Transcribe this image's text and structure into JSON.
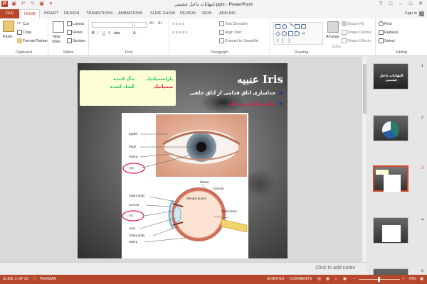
{
  "window": {
    "title": "انتهابات داخل چشمی.pptx - PowerPoint"
  },
  "tabs": [
    "FILE",
    "HOME",
    "INSERT",
    "DESIGN",
    "TRANSITIONS",
    "ANIMATIONS",
    "SLIDE SHOW",
    "REVIEW",
    "VIEW",
    "ADD-INS"
  ],
  "active_tab": "HOME",
  "account": {
    "sign_in": "Sign in"
  },
  "ribbon": {
    "clipboard": {
      "paste": "Paste",
      "cut": "Cut",
      "copy": "Copy",
      "format_painter": "Format Painter",
      "label": "Clipboard"
    },
    "slides": {
      "new_slide": "New",
      "new_slide_2": "Slide",
      "layout": "Layout",
      "reset": "Reset",
      "section": "Section",
      "label": "Slides"
    },
    "font": {
      "label": "Font"
    },
    "paragraph": {
      "text_direction": "Text Direction",
      "align_text": "Align Text",
      "convert_smartart": "Convert to SmartArt",
      "label": "Paragraph"
    },
    "drawing": {
      "arrange": "Arrange",
      "quick_styles": "Quick",
      "quick_styles_2": "Styles",
      "shape_fill": "Shape Fill",
      "shape_outline": "Shape Outline",
      "shape_effects": "Shape Effects",
      "label": "Drawing"
    },
    "editing": {
      "find": "Find",
      "replace": "Replace",
      "select": "Select",
      "label": "Editing"
    }
  },
  "slide": {
    "title": "عنبیه Iris",
    "legend": {
      "row1_label": "تنگ کننده",
      "row1_value": "پاراسمپاتیک",
      "row2_label": "گشاد کننده",
      "row2_value": "سمپاتیک"
    },
    "bullets": [
      "جداسازی اتاق قدامی از اتاق خلفی",
      "تنظیم قطر مردمک"
    ],
    "figure_labels": {
      "eyelid": "Eyelid",
      "pupil": "Pupil",
      "sclera": "Sclera",
      "iris": "Iris",
      "ciliary_body": "Ciliary body",
      "cornea": "Cornea",
      "iris2": "Iris",
      "lens": "Lens",
      "ciliary_body2": "Ciliary body",
      "sclera2": "Sclera",
      "retina": "Retina",
      "choroid": "Choroid",
      "vitreous_humor": "Vitreous humor",
      "optic_nerve": "Optic nerve"
    }
  },
  "thumbnails": [
    {
      "number": "1",
      "text": "التهابات داخل چشمی"
    },
    {
      "number": "2",
      "text": ""
    },
    {
      "number": "3",
      "text": ""
    },
    {
      "number": "4",
      "text": ""
    },
    {
      "number": "5",
      "text": ""
    }
  ],
  "notes": {
    "placeholder": "Click to add notes"
  },
  "status": {
    "slide_info": "SLIDE 3 OF 25",
    "language": "PERSIAN",
    "notes": "NOTES",
    "comments": "COMMENTS",
    "zoom": "70%"
  },
  "colors": {
    "accent": "#b7472a",
    "legend_bg": "#ffffd6",
    "legend_green": "#22c55e",
    "legend_red": "#e11d48",
    "circle_red": "#e11d48"
  }
}
